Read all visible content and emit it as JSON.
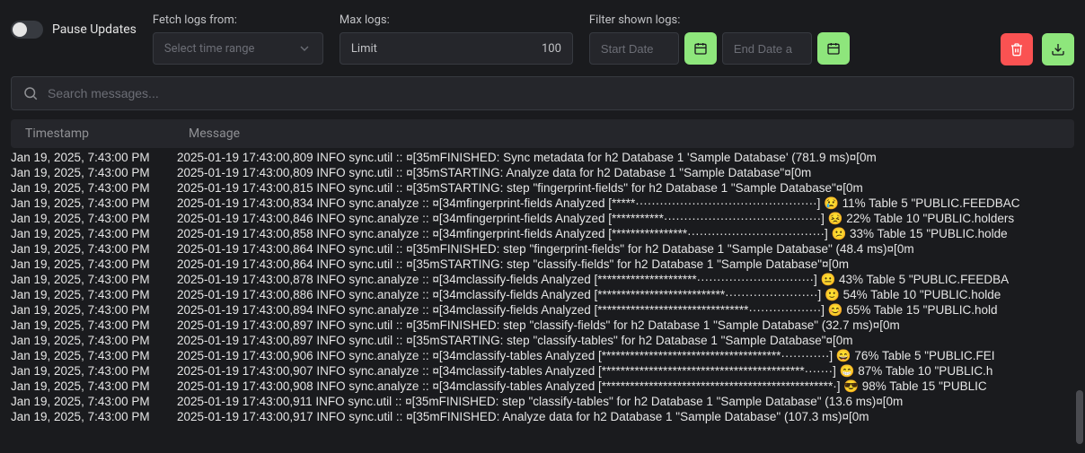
{
  "toolbar": {
    "pause_label": "Pause Updates",
    "fetch_label": "Fetch logs from:",
    "select_placeholder": "Select time range",
    "maxlogs_label": "Max logs:",
    "limit_placeholder": "Limit",
    "limit_value": "100",
    "filter_label": "Filter shown logs:",
    "start_placeholder": "Start Date",
    "end_placeholder": "End Date a"
  },
  "search": {
    "placeholder": "Search messages..."
  },
  "columns": {
    "timestamp": "Timestamp",
    "message": "Message"
  },
  "logs": [
    {
      "ts": "Jan 19, 2025, 7:43:00 PM",
      "msg": "2025-01-19 17:43:00,809 INFO sync.util :: ¤[35mFINISHED: Sync metadata for h2 Database 1 'Sample Database' (781.9 ms)¤[0m"
    },
    {
      "ts": "Jan 19, 2025, 7:43:00 PM",
      "msg": "2025-01-19 17:43:00,809 INFO sync.util :: ¤[35mSTARTING: Analyze data for h2 Database 1 \"Sample Database\"¤[0m"
    },
    {
      "ts": "Jan 19, 2025, 7:43:00 PM",
      "msg": "2025-01-19 17:43:00,815 INFO sync.util :: ¤[35mSTARTING: step \"fingerprint-fields\" for h2 Database 1 \"Sample Database\"¤[0m"
    },
    {
      "ts": "Jan 19, 2025, 7:43:00 PM",
      "msg": "2025-01-19 17:43:00,834 INFO sync.analyze :: ¤[34mfingerprint-fields Analyzed [*****·············································] 😢 11% Table 5 \"PUBLIC.FEEDBAC"
    },
    {
      "ts": "Jan 19, 2025, 7:43:00 PM",
      "msg": "2025-01-19 17:43:00,846 INFO sync.analyze :: ¤[34mfingerprint-fields Analyzed [***********·······································] 😣 22% Table 10 \"PUBLIC.holders"
    },
    {
      "ts": "Jan 19, 2025, 7:43:00 PM",
      "msg": "2025-01-19 17:43:00,858 INFO sync.analyze :: ¤[34mfingerprint-fields Analyzed [****************··································] 😕 33% Table 15 \"PUBLIC.holde"
    },
    {
      "ts": "Jan 19, 2025, 7:43:00 PM",
      "msg": "2025-01-19 17:43:00,864 INFO sync.util :: ¤[35mFINISHED: step \"fingerprint-fields\" for h2 Database 1 \"Sample Database\" (48.4 ms)¤[0m"
    },
    {
      "ts": "Jan 19, 2025, 7:43:00 PM",
      "msg": "2025-01-19 17:43:00,864 INFO sync.util :: ¤[35mSTARTING: step \"classify-fields\" for h2 Database 1 \"Sample Database\"¤[0m"
    },
    {
      "ts": "Jan 19, 2025, 7:43:00 PM",
      "msg": "2025-01-19 17:43:00,878 INFO sync.analyze :: ¤[34mclassify-fields Analyzed [*********************·····························] 😐 43% Table 5 \"PUBLIC.FEEDBA"
    },
    {
      "ts": "Jan 19, 2025, 7:43:00 PM",
      "msg": "2025-01-19 17:43:00,886 INFO sync.analyze :: ¤[34mclassify-fields Analyzed [***************************·······················] 🙂 54% Table 10 \"PUBLIC.holde"
    },
    {
      "ts": "Jan 19, 2025, 7:43:00 PM",
      "msg": "2025-01-19 17:43:00,894 INFO sync.analyze :: ¤[34mclassify-fields Analyzed [********************************··················] 😊 65% Table 15 \"PUBLIC.hold"
    },
    {
      "ts": "Jan 19, 2025, 7:43:00 PM",
      "msg": "2025-01-19 17:43:00,897 INFO sync.util :: ¤[35mFINISHED: step \"classify-fields\" for h2 Database 1 \"Sample Database\" (32.7 ms)¤[0m"
    },
    {
      "ts": "Jan 19, 2025, 7:43:00 PM",
      "msg": "2025-01-19 17:43:00,897 INFO sync.util :: ¤[35mSTARTING: step \"classify-tables\" for h2 Database 1 \"Sample Database\"¤[0m"
    },
    {
      "ts": "Jan 19, 2025, 7:43:00 PM",
      "msg": "2025-01-19 17:43:00,906 INFO sync.analyze :: ¤[34mclassify-tables Analyzed [**************************************············] 😄 76% Table 5 \"PUBLIC.FEI"
    },
    {
      "ts": "Jan 19, 2025, 7:43:00 PM",
      "msg": "2025-01-19 17:43:00,907 INFO sync.analyze :: ¤[34mclassify-tables Analyzed [*******************************************·······] 😁 87% Table 10 \"PUBLIC.h"
    },
    {
      "ts": "Jan 19, 2025, 7:43:00 PM",
      "msg": "2025-01-19 17:43:00,908 INFO sync.analyze :: ¤[34mclassify-tables Analyzed [*************************************************·] 😎 98% Table 15 \"PUBLIC"
    },
    {
      "ts": "Jan 19, 2025, 7:43:00 PM",
      "msg": "2025-01-19 17:43:00,911 INFO sync.util :: ¤[35mFINISHED: step \"classify-tables\" for h2 Database 1 \"Sample Database\" (13.6 ms)¤[0m"
    },
    {
      "ts": "Jan 19, 2025, 7:43:00 PM",
      "msg": "2025-01-19 17:43:00,917 INFO sync.util :: ¤[35mFINISHED: Analyze data for h2 Database 1 \"Sample Database\" (107.3 ms)¤[0m"
    }
  ]
}
